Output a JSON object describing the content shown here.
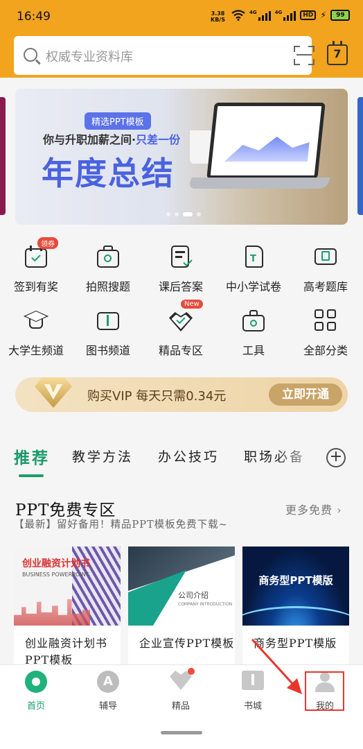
{
  "status": {
    "time": "16:49",
    "net_speed": "3.38",
    "net_unit": "KB/S",
    "sig1": "4G",
    "sig2": "4G",
    "hd": "HD",
    "battery": "99"
  },
  "header": {
    "search_placeholder": "权威专业资料库",
    "calendar_day": "7"
  },
  "banner": {
    "tag": "精选PPT模板",
    "line_prefix": "你与升职加薪之间·",
    "line_highlight": "只差一份",
    "headline": "年度总结",
    "slide_count": 4,
    "active_slide": 3
  },
  "shortcuts": [
    {
      "label": "签到有奖",
      "icon": "sign-in-calendar-icon",
      "badge": "领券"
    },
    {
      "label": "拍照搜题",
      "icon": "camera-search-icon",
      "badge": ""
    },
    {
      "label": "课后答案",
      "icon": "answer-checklist-icon",
      "badge": ""
    },
    {
      "label": "中小学试卷",
      "icon": "test-paper-icon",
      "badge": ""
    },
    {
      "label": "高考题库",
      "icon": "question-bank-icon",
      "badge": ""
    },
    {
      "label": "大学生频道",
      "icon": "graduation-cap-icon",
      "badge": ""
    },
    {
      "label": "图书频道",
      "icon": "open-book-icon",
      "badge": ""
    },
    {
      "label": "精品专区",
      "icon": "premium-heart-icon",
      "badge": "New"
    },
    {
      "label": "工具",
      "icon": "toolbox-icon",
      "badge": ""
    },
    {
      "label": "全部分类",
      "icon": "all-categories-grid-icon",
      "badge": ""
    }
  ],
  "vip": {
    "text": "购买VIP 每天只需0.34元",
    "button": "立即开通"
  },
  "tabs": [
    {
      "label": "推荐",
      "active": true
    },
    {
      "label": "教学方法",
      "active": false
    },
    {
      "label": "办公技巧",
      "active": false
    },
    {
      "label": "职场必备",
      "active": false
    }
  ],
  "section": {
    "title": "PPT免费专区",
    "more": "更多免费",
    "subtitle": "【最新】留好备用！精品PPT模板免费下载~"
  },
  "cards": [
    {
      "title": "创业融资计划书PPT模板",
      "thumb_title": "创业融资计划书",
      "thumb_sub": "BUSINESS POWERPOINT"
    },
    {
      "title": "企业宣传PPT模板",
      "thumb_title": "公司介绍",
      "thumb_sub": "COMPANY INTRODUCTION"
    },
    {
      "title": "商务型PPT模版",
      "thumb_title": "商务型PPT模版",
      "thumb_sub": ""
    }
  ],
  "bottom_nav": [
    {
      "label": "首页",
      "icon": "home-icon",
      "active": true
    },
    {
      "label": "辅导",
      "icon": "tutoring-icon",
      "active": false
    },
    {
      "label": "精品",
      "icon": "premium-icon",
      "active": false
    },
    {
      "label": "书城",
      "icon": "bookstore-icon",
      "active": false
    },
    {
      "label": "我的",
      "icon": "profile-icon",
      "active": false
    }
  ],
  "colors": {
    "header": "#f2a41f",
    "accent_green": "#1aa06a",
    "banner_blue": "#4a62e0",
    "vip_gold": "#c9a468",
    "annotation_red": "#e8362f"
  }
}
